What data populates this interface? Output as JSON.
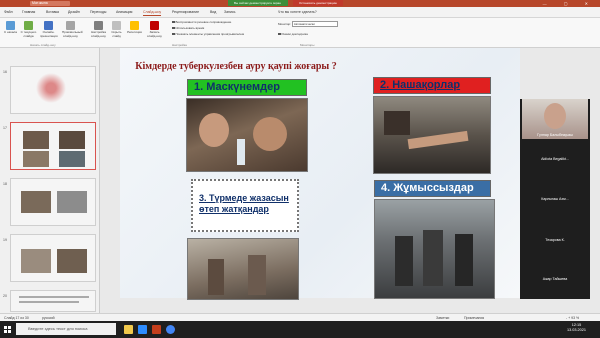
{
  "titlebar": {
    "doc_chip": "Мат.жына"
  },
  "share": {
    "sharing_label": "Вы сейчас демонстрируете экран",
    "stop_label": "Остановить демонстрацию"
  },
  "tabs": [
    "Файл",
    "Главная",
    "Вставка",
    "Дизайн",
    "Переходы",
    "Анимация",
    "Слайд-шоу",
    "Рецензирование",
    "Вид",
    "Запись",
    "Что вы хотите сделать?"
  ],
  "ribbon": {
    "buttons": [
      "С начала",
      "С текущего слайда",
      "Онлайн-презентация",
      "Произвольный слайд-шоу",
      "Настройка слайд-шоу",
      "Скрыть слайд",
      "Репетиция",
      "Запись слайд-шоу"
    ],
    "checks": [
      "Воспроизвести речевое сопровождение",
      "Использовать время",
      "Показать элементы управления проигрывателем"
    ],
    "monitor_label": "Монитор:",
    "monitor_value": "Автоматически",
    "presenter_view": "Режим докладчика",
    "groups": [
      "Начать слайд-шоу",
      "Настройка",
      "Мониторы"
    ]
  },
  "slides_panel": {
    "numbers": [
      "16",
      "17",
      "18",
      "19",
      "20"
    ]
  },
  "slide": {
    "title": "Кімдерде туберкулезбен ауру қаупі жоғары ?",
    "label1": "1. Маскүнемдер",
    "label2": "2. Нашақорлар",
    "label3": "3. Түрмеде жазасын өтеп жатқандар",
    "label4": "4. Жұмыссыздар",
    "colors": {
      "label1_bg": "#22c122",
      "label2_bg": "#e02020",
      "label4_bg": "#3a6ea5",
      "title": "#8b1a1a"
    }
  },
  "video_panel": {
    "names": [
      "Гүлнар Балыбекқызы",
      "Aidiota Begalikt...",
      "Карлыгаш Ахм...",
      "Тезарова К.",
      "Ажар Тайшева"
    ]
  },
  "statusbar": {
    "left": "Слайд 17 из 30",
    "lang": "русский",
    "notes": "Заметки",
    "comments": "Примечания",
    "zoom": "- + 93 %"
  },
  "taskbar": {
    "search_placeholder": "Введите здесь текст для поиска",
    "time": "12:15",
    "date": "13.03.2021"
  }
}
